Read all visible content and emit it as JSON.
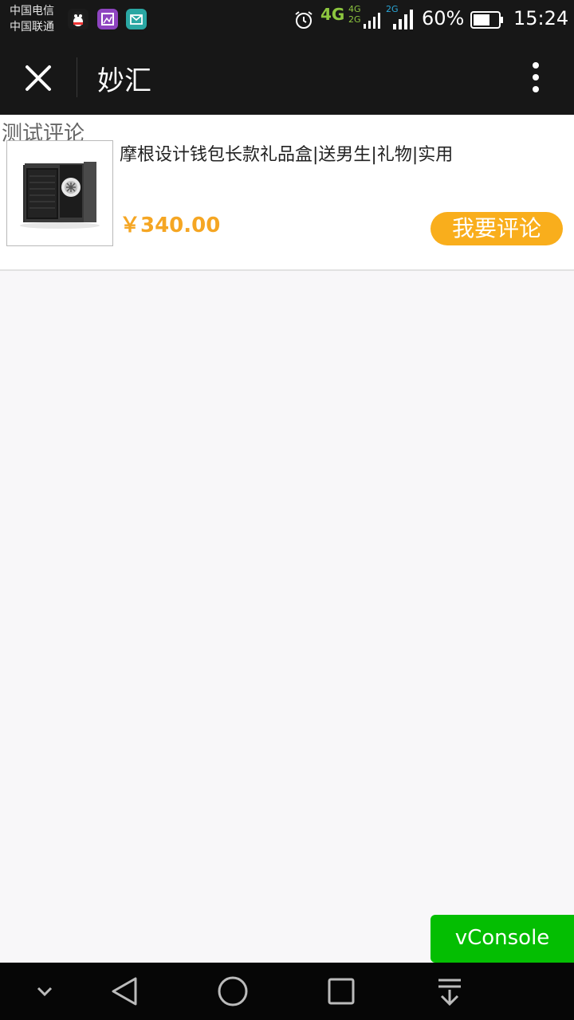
{
  "status_bar": {
    "carriers": [
      "中国电信",
      "中国联通"
    ],
    "network_primary": "4G",
    "network_secondary_top": "4G",
    "network_secondary_bottom": "2G",
    "network_tertiary": "2G",
    "battery_percent": "60%",
    "time": "15:24",
    "icons": [
      "qq-icon",
      "gallery-icon",
      "mail-icon",
      "alarm-icon",
      "signal-icon",
      "battery-icon"
    ]
  },
  "nav": {
    "title": "妙汇"
  },
  "page": {
    "section_label": "测试评论",
    "product": {
      "title": "摩根设计钱包长款礼品盒|送男生|礼物|实用",
      "price": "￥340.00",
      "review_button": "我要评论"
    }
  },
  "vconsole": {
    "label": "vConsole"
  },
  "colors": {
    "accent": "#f9ae1c",
    "price": "#f5a623",
    "vconsole": "#04be02",
    "bar": "#171717"
  }
}
